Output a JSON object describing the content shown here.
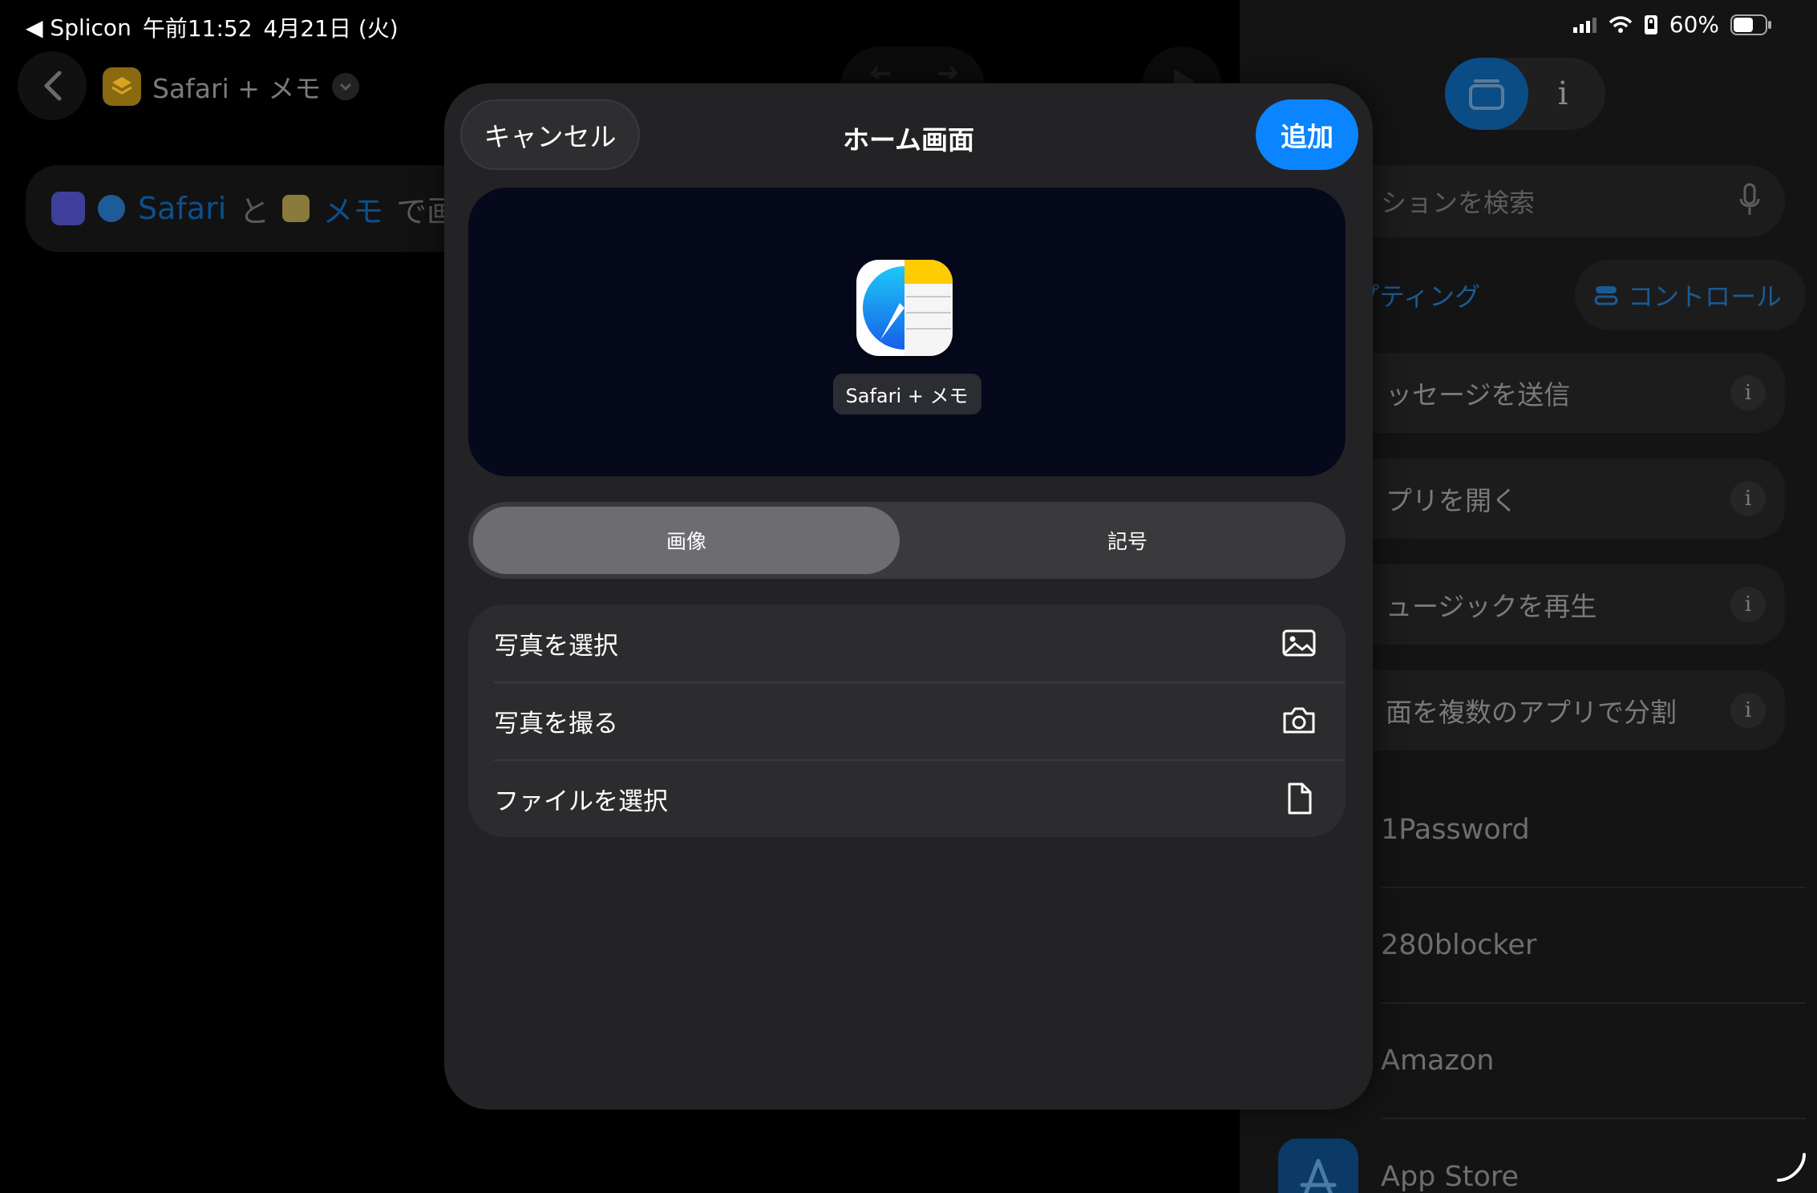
{
  "status_bar": {
    "back_app": "◀ Splicon",
    "time": "午前11:52",
    "date": "4月21日 (火)",
    "battery": "60%"
  },
  "editor": {
    "shortcut_name": "Safari + メモ",
    "action_parts": {
      "app1": "Safari",
      "connector": "と",
      "app2": "メモ",
      "suffix": "で画"
    }
  },
  "library": {
    "search_placeholder": "ションを検索",
    "chips": [
      "リプティング",
      "コントロール"
    ],
    "actions": [
      "ッセージを送信",
      "プリを開く",
      "ュージックを再生",
      "面を複数のアプリで分割"
    ],
    "info_glyph": "i",
    "apps": [
      "1Password",
      "280blocker",
      "Amazon",
      "App Store"
    ]
  },
  "modal": {
    "cancel": "キャンセル",
    "title": "ホーム画面",
    "add": "追加",
    "preview_label": "Safari + メモ",
    "segments": [
      "画像",
      "記号"
    ],
    "selected_segment": "画像",
    "menu": [
      {
        "label": "写真を選択",
        "icon": "photo-icon"
      },
      {
        "label": "写真を撮る",
        "icon": "camera-icon"
      },
      {
        "label": "ファイルを選択",
        "icon": "file-icon"
      }
    ]
  },
  "colors": {
    "accent": "#0a84ff",
    "modal_bg": "#232325",
    "preview_bg": "#05091b"
  }
}
